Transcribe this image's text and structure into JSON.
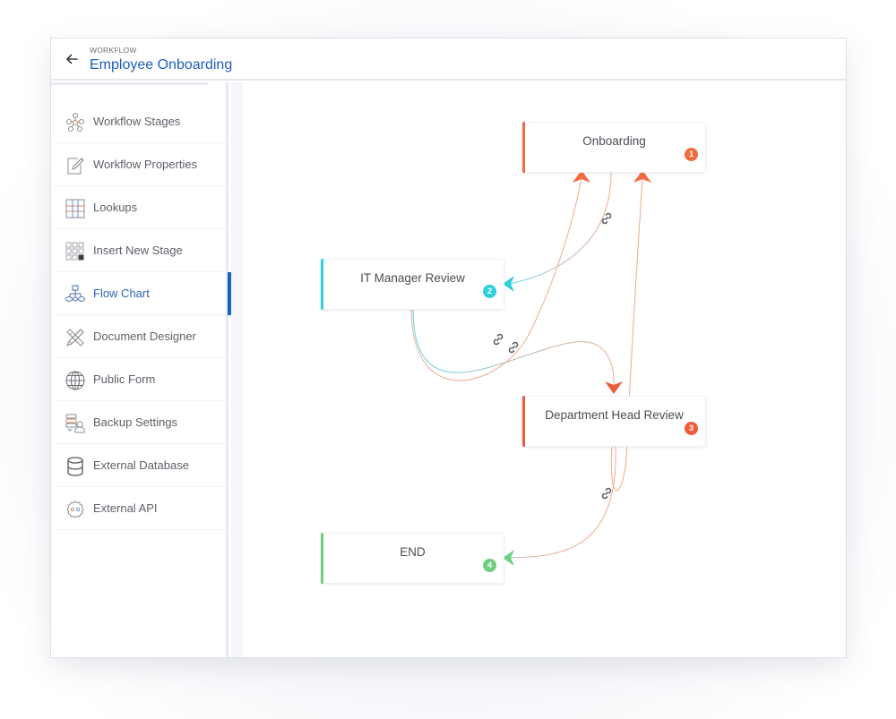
{
  "header": {
    "subtitle": "WORKFLOW",
    "title": "Employee Onboarding",
    "back_icon": "arrow-left-icon"
  },
  "sidebar": {
    "active_index": 4,
    "items": [
      {
        "label": "Workflow Stages",
        "icon": "stages-network-icon"
      },
      {
        "label": "Workflow Properties",
        "icon": "edit-document-icon"
      },
      {
        "label": "Lookups",
        "icon": "grid-table-icon"
      },
      {
        "label": "Insert New Stage",
        "icon": "insert-grid-icon"
      },
      {
        "label": "Flow Chart",
        "icon": "flowchart-icon"
      },
      {
        "label": "Document Designer",
        "icon": "pencil-ruler-icon"
      },
      {
        "label": "Public Form",
        "icon": "globe-icon"
      },
      {
        "label": "Backup Settings",
        "icon": "backup-database-icon"
      },
      {
        "label": "External Database",
        "icon": "database-icon"
      },
      {
        "label": "External API",
        "icon": "api-gear-icon"
      }
    ]
  },
  "flowchart": {
    "nodes": [
      {
        "id": "1",
        "title": "Onboarding",
        "badge": "1",
        "color": "#f26a3d"
      },
      {
        "id": "2",
        "title": "IT Manager Review",
        "badge": "2",
        "color": "#2fd0dc"
      },
      {
        "id": "3",
        "title": "Department Head Review",
        "badge": "3",
        "color": "#ef5a3b"
      },
      {
        "id": "4",
        "title": "END",
        "badge": "4",
        "color": "#6fcf7c"
      }
    ],
    "edges": [
      {
        "from": "1",
        "to": "2"
      },
      {
        "from": "2",
        "to": "1"
      },
      {
        "from": "2",
        "to": "3"
      },
      {
        "from": "3",
        "to": "1"
      },
      {
        "from": "3",
        "to": "4"
      }
    ],
    "link_icon": "chain-link-icon"
  }
}
